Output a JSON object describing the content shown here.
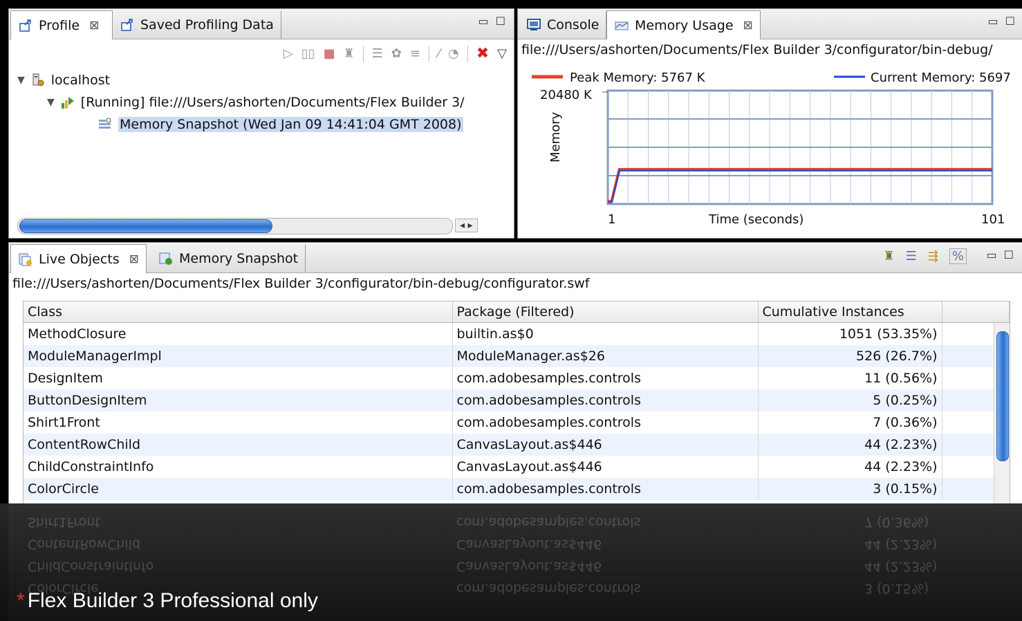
{
  "profile_panel": {
    "tabs": [
      {
        "label": "Profile",
        "active": true,
        "icon": "profile-icon"
      },
      {
        "label": "Saved Profiling Data",
        "active": false,
        "icon": "saved-data-icon"
      }
    ],
    "tree": {
      "host": "localhost",
      "session": "[Running] file:///Users/ashorten/Documents/Flex Builder 3/",
      "snapshot": "Memory Snapshot (Wed Jan 09 14:41:04 GMT 2008)"
    }
  },
  "memory_panel": {
    "tabs": [
      {
        "label": "Console",
        "active": false,
        "icon": "console-icon"
      },
      {
        "label": "Memory Usage",
        "active": true,
        "icon": "memory-usage-icon"
      }
    ],
    "path": "file:///Users/ashorten/Documents/Flex Builder 3/configurator/bin-debug/",
    "chart_data": {
      "type": "line",
      "series": [
        {
          "name": "Peak Memory: 5767 K",
          "color": "#e8421c",
          "x": [
            1,
            2,
            4,
            101
          ],
          "y": [
            0,
            0,
            5767,
            5767
          ]
        },
        {
          "name": "Current Memory: 5697",
          "color": "#1f48d6",
          "x": [
            1,
            2,
            4,
            25,
            101
          ],
          "y": [
            0,
            0,
            5697,
            5697,
            5697
          ]
        }
      ],
      "ymax_label": "20480 K",
      "ylabel": "Memory",
      "xlabel": "Time (seconds)",
      "xmin_label": "1",
      "xmax_label": "101",
      "xlim": [
        1,
        101
      ],
      "ylim": [
        0,
        20480
      ],
      "grid": true
    }
  },
  "objects_panel": {
    "tabs": [
      {
        "label": "Live Objects",
        "active": true,
        "icon": "live-objects-icon"
      },
      {
        "label": "Memory Snapshot",
        "active": false,
        "icon": "memory-snapshot-icon"
      }
    ],
    "path": "file:///Users/ashorten/Documents/Flex Builder 3/configurator/bin-debug/configurator.swf",
    "columns": [
      "Class",
      "Package (Filtered)",
      "Cumulative Instances"
    ],
    "rows": [
      [
        "MethodClosure",
        "builtin.as$0",
        "1051 (53.35%)"
      ],
      [
        "ModuleManagerImpl",
        "ModuleManager.as$26",
        "526 (26.7%)"
      ],
      [
        "DesignItem",
        "com.adobesamples.controls",
        "11 (0.56%)"
      ],
      [
        "ButtonDesignItem",
        "com.adobesamples.controls",
        "5 (0.25%)"
      ],
      [
        "Shirt1Front",
        "com.adobesamples.controls",
        "7 (0.36%)"
      ],
      [
        "ContentRowChild",
        "CanvasLayout.as$446",
        "44 (2.23%)"
      ],
      [
        "ChildConstraintInfo",
        "CanvasLayout.as$446",
        "44 (2.23%)"
      ],
      [
        "ColorCircle",
        "com.adobesamples.controls",
        "3 (0.15%)"
      ]
    ]
  },
  "caption": {
    "star": "*",
    "text": "Flex Builder 3 Professional only"
  }
}
